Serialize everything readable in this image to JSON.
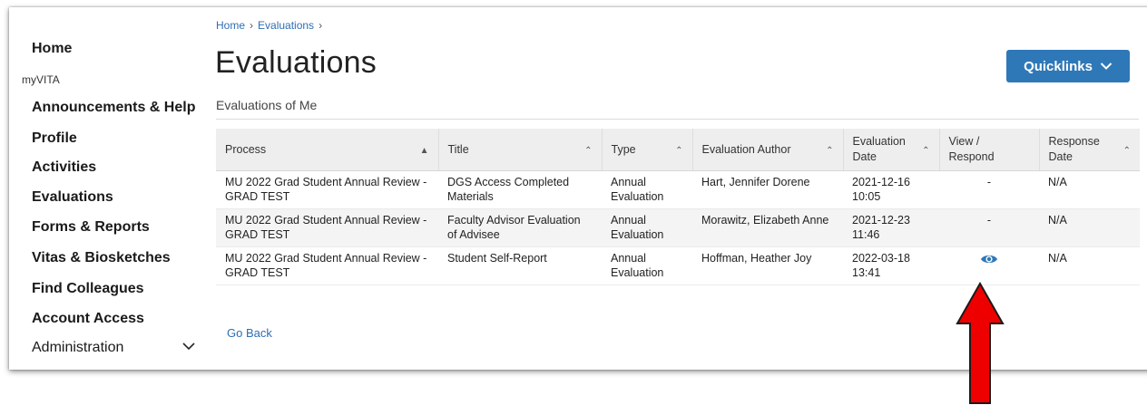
{
  "sidebar": {
    "items": [
      {
        "label": "Home"
      },
      {
        "label": "myVITA"
      },
      {
        "label": "Announcements & Help"
      },
      {
        "label": "Profile"
      },
      {
        "label": "Activities"
      },
      {
        "label": "Evaluations"
      },
      {
        "label": "Forms & Reports"
      },
      {
        "label": "Vitas & Biosketches"
      },
      {
        "label": "Find Colleagues"
      },
      {
        "label": "Account Access"
      },
      {
        "label": "Administration"
      }
    ]
  },
  "breadcrumb": {
    "home": "Home",
    "evaluations": "Evaluations",
    "sep": "›"
  },
  "header": {
    "title": "Evaluations",
    "subtitle": "Evaluations of Me",
    "quicklinks_label": "Quicklinks"
  },
  "table": {
    "columns": [
      "Process",
      "Title",
      "Type",
      "Evaluation Author",
      "Evaluation Date",
      "View / Respond",
      "Response Date"
    ],
    "rows": [
      {
        "process": "MU 2022 Grad Student Annual Review - GRAD TEST",
        "title": "DGS Access Completed Materials",
        "type": "Annual Evaluation",
        "author": "Hart, Jennifer Dorene",
        "date": "2021-12-16 10:05",
        "view": "-",
        "response": "N/A"
      },
      {
        "process": "MU 2022 Grad Student Annual Review - GRAD TEST",
        "title": "Faculty Advisor Evaluation of Advisee",
        "type": "Annual Evaluation",
        "author": "Morawitz, Elizabeth Anne",
        "date": "2021-12-23 11:46",
        "view": "-",
        "response": "N/A"
      },
      {
        "process": "MU 2022 Grad Student Annual Review - GRAD TEST",
        "title": "Student Self-Report",
        "type": "Annual Evaluation",
        "author": "Hoffman, Heather Joy",
        "date": "2022-03-18 13:41",
        "view": "eye-icon",
        "response": "N/A"
      }
    ]
  },
  "footer": {
    "go_back": "Go Back"
  },
  "colors": {
    "accent": "#2e78b7",
    "link": "#2e6db4",
    "annotation_arrow": "#ee0000"
  }
}
